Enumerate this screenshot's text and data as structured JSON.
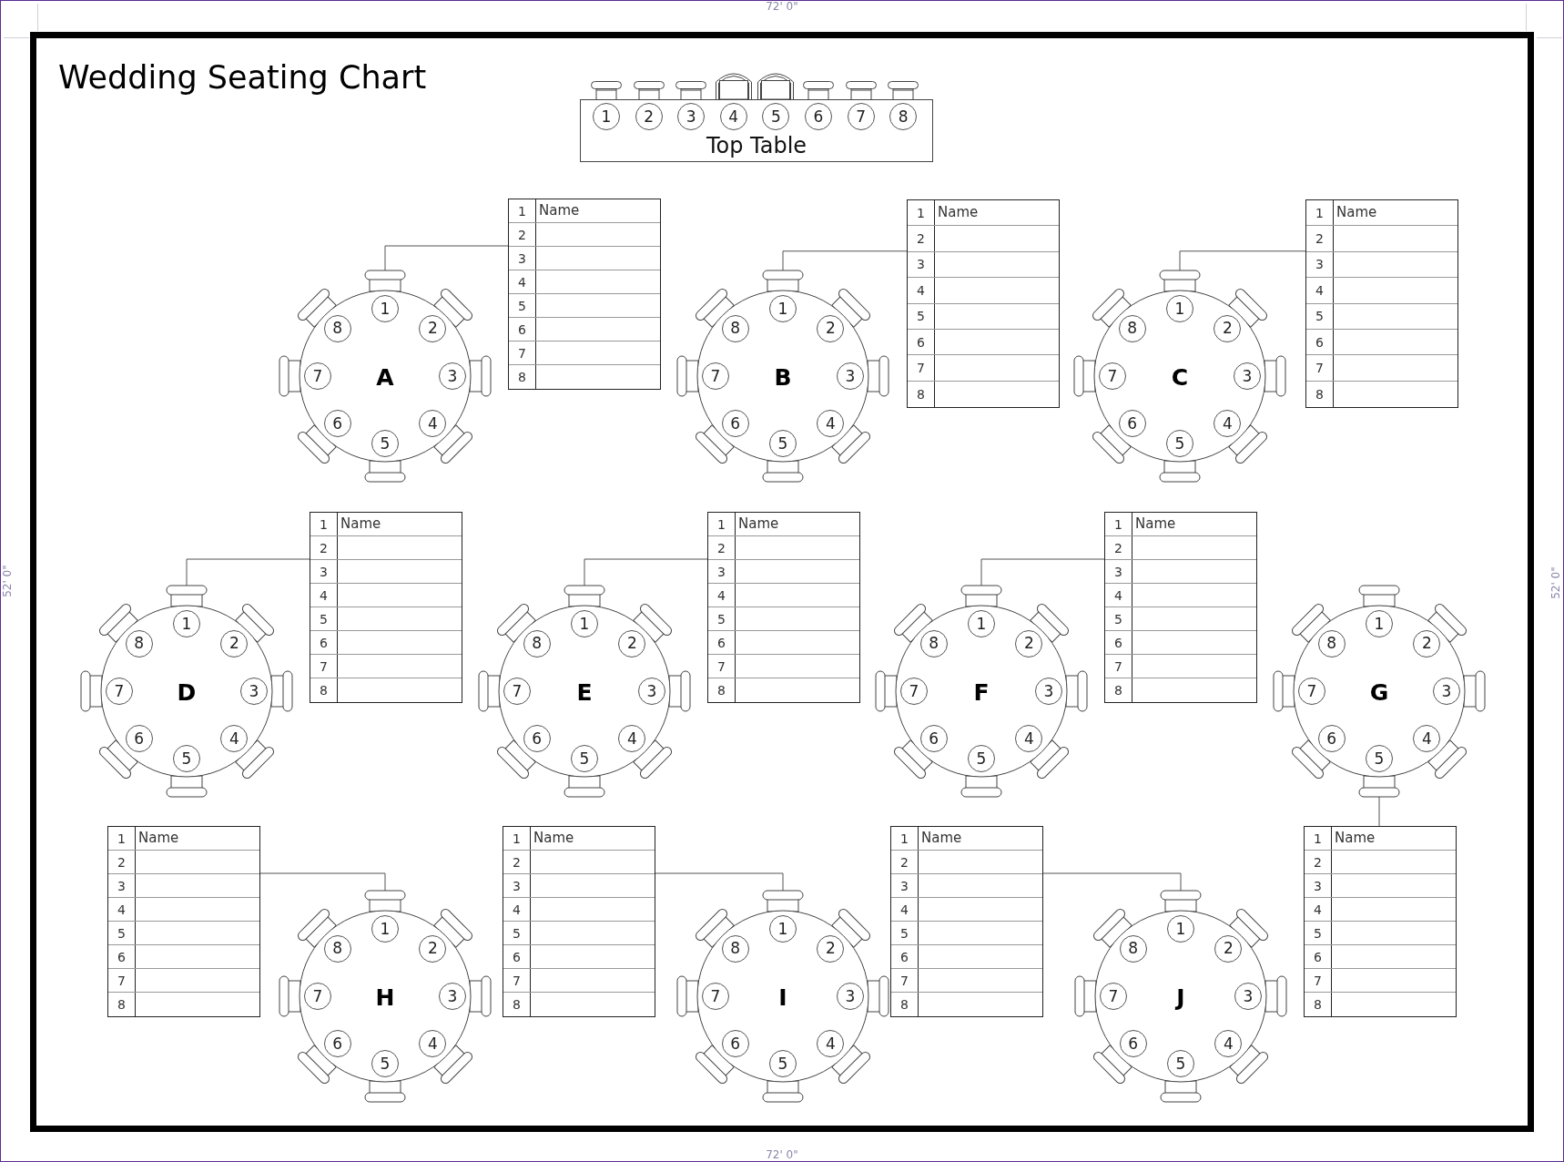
{
  "rulers": {
    "top": "72' 0\"",
    "left": "52' 0\"",
    "right": "52' 0\"",
    "bottom": "72' 0\""
  },
  "title": "Wedding Seating Chart",
  "top_table": {
    "label": "Top Table",
    "seats": [
      {
        "number": "1",
        "kind": "chair"
      },
      {
        "number": "2",
        "kind": "chair"
      },
      {
        "number": "3",
        "kind": "chair"
      },
      {
        "number": "4",
        "kind": "armchair"
      },
      {
        "number": "5",
        "kind": "armchair"
      },
      {
        "number": "6",
        "kind": "chair"
      },
      {
        "number": "7",
        "kind": "chair"
      },
      {
        "number": "8",
        "kind": "chair"
      }
    ]
  },
  "tables": [
    {
      "label": "A",
      "seats": [
        "1",
        "2",
        "3",
        "4",
        "5",
        "6",
        "7",
        "8"
      ],
      "guest_list": [
        {
          "number": "1",
          "label": "Name"
        },
        {
          "number": "2"
        },
        {
          "number": "3"
        },
        {
          "number": "4"
        },
        {
          "number": "5"
        },
        {
          "number": "6"
        },
        {
          "number": "7"
        },
        {
          "number": "8"
        }
      ]
    },
    {
      "label": "B",
      "seats": [
        "1",
        "2",
        "3",
        "4",
        "5",
        "6",
        "7",
        "8"
      ],
      "guest_list": [
        {
          "number": "1",
          "label": "Name"
        },
        {
          "number": "2"
        },
        {
          "number": "3"
        },
        {
          "number": "4"
        },
        {
          "number": "5"
        },
        {
          "number": "6"
        },
        {
          "number": "7"
        },
        {
          "number": "8"
        }
      ]
    },
    {
      "label": "C",
      "seats": [
        "1",
        "2",
        "3",
        "4",
        "5",
        "6",
        "7",
        "8"
      ],
      "guest_list": [
        {
          "number": "1",
          "label": "Name"
        },
        {
          "number": "2"
        },
        {
          "number": "3"
        },
        {
          "number": "4"
        },
        {
          "number": "5"
        },
        {
          "number": "6"
        },
        {
          "number": "7"
        },
        {
          "number": "8"
        }
      ]
    },
    {
      "label": "D",
      "seats": [
        "1",
        "2",
        "3",
        "4",
        "5",
        "6",
        "7",
        "8"
      ],
      "guest_list": [
        {
          "number": "1",
          "label": "Name"
        },
        {
          "number": "2"
        },
        {
          "number": "3"
        },
        {
          "number": "4"
        },
        {
          "number": "5"
        },
        {
          "number": "6"
        },
        {
          "number": "7"
        },
        {
          "number": "8"
        }
      ]
    },
    {
      "label": "E",
      "seats": [
        "1",
        "2",
        "3",
        "4",
        "5",
        "6",
        "7",
        "8"
      ],
      "guest_list": [
        {
          "number": "1",
          "label": "Name"
        },
        {
          "number": "2"
        },
        {
          "number": "3"
        },
        {
          "number": "4"
        },
        {
          "number": "5"
        },
        {
          "number": "6"
        },
        {
          "number": "7"
        },
        {
          "number": "8"
        }
      ]
    },
    {
      "label": "F",
      "seats": [
        "1",
        "2",
        "3",
        "4",
        "5",
        "6",
        "7",
        "8"
      ],
      "guest_list": [
        {
          "number": "1",
          "label": "Name"
        },
        {
          "number": "2"
        },
        {
          "number": "3"
        },
        {
          "number": "4"
        },
        {
          "number": "5"
        },
        {
          "number": "6"
        },
        {
          "number": "7"
        },
        {
          "number": "8"
        }
      ]
    },
    {
      "label": "G",
      "seats": [
        "1",
        "2",
        "3",
        "4",
        "5",
        "6",
        "7",
        "8"
      ],
      "guest_list": [
        {
          "number": "1",
          "label": "Name"
        },
        {
          "number": "2"
        },
        {
          "number": "3"
        },
        {
          "number": "4"
        },
        {
          "number": "5"
        },
        {
          "number": "6"
        },
        {
          "number": "7"
        },
        {
          "number": "8"
        }
      ]
    },
    {
      "label": "H",
      "seats": [
        "1",
        "2",
        "3",
        "4",
        "5",
        "6",
        "7",
        "8"
      ],
      "guest_list": [
        {
          "number": "1",
          "label": "Name"
        },
        {
          "number": "2"
        },
        {
          "number": "3"
        },
        {
          "number": "4"
        },
        {
          "number": "5"
        },
        {
          "number": "6"
        },
        {
          "number": "7"
        },
        {
          "number": "8"
        }
      ]
    },
    {
      "label": "I",
      "seats": [
        "1",
        "2",
        "3",
        "4",
        "5",
        "6",
        "7",
        "8"
      ],
      "guest_list": [
        {
          "number": "1",
          "label": "Name"
        },
        {
          "number": "2"
        },
        {
          "number": "3"
        },
        {
          "number": "4"
        },
        {
          "number": "5"
        },
        {
          "number": "6"
        },
        {
          "number": "7"
        },
        {
          "number": "8"
        }
      ]
    },
    {
      "label": "J",
      "seats": [
        "1",
        "2",
        "3",
        "4",
        "5",
        "6",
        "7",
        "8"
      ],
      "guest_list": [
        {
          "number": "1",
          "label": "Name"
        },
        {
          "number": "2"
        },
        {
          "number": "3"
        },
        {
          "number": "4"
        },
        {
          "number": "5"
        },
        {
          "number": "6"
        },
        {
          "number": "7"
        },
        {
          "number": "8"
        }
      ]
    }
  ]
}
